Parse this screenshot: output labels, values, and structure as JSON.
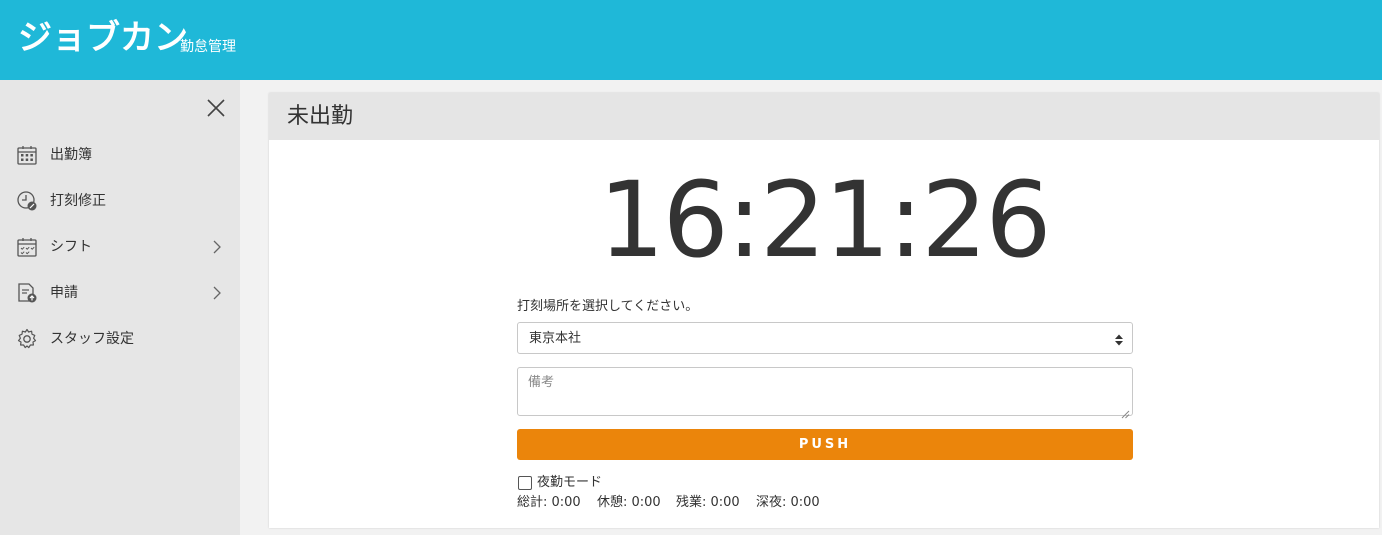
{
  "header": {
    "logo": "ジョブカン",
    "logo_sub": "勤怠管理",
    "brand_color": "#1fb8d8"
  },
  "sidebar": {
    "close_icon": "close-icon",
    "items": [
      {
        "label": "出勤簿",
        "icon": "calendar-icon",
        "has_submenu": false
      },
      {
        "label": "打刻修正",
        "icon": "clock-edit-icon",
        "has_submenu": false
      },
      {
        "label": "シフト",
        "icon": "shift-calendar-icon",
        "has_submenu": true
      },
      {
        "label": "申請",
        "icon": "document-upload-icon",
        "has_submenu": true
      },
      {
        "label": "スタッフ設定",
        "icon": "gear-icon",
        "has_submenu": false
      }
    ]
  },
  "main": {
    "status_title": "未出勤",
    "clock": "16:21:26",
    "location_label": "打刻場所を選択してください。",
    "location_selected": "東京本社",
    "note_placeholder": "備考",
    "push_label": "PUSH",
    "push_color": "#eb850b",
    "night_mode_label": "夜勤モード",
    "night_mode_checked": false,
    "summary": [
      {
        "text": "総計: 0:00"
      },
      {
        "text": "休憩: 0:00"
      },
      {
        "text": "残業: 0:00"
      },
      {
        "text": "深夜: 0:00"
      }
    ]
  }
}
